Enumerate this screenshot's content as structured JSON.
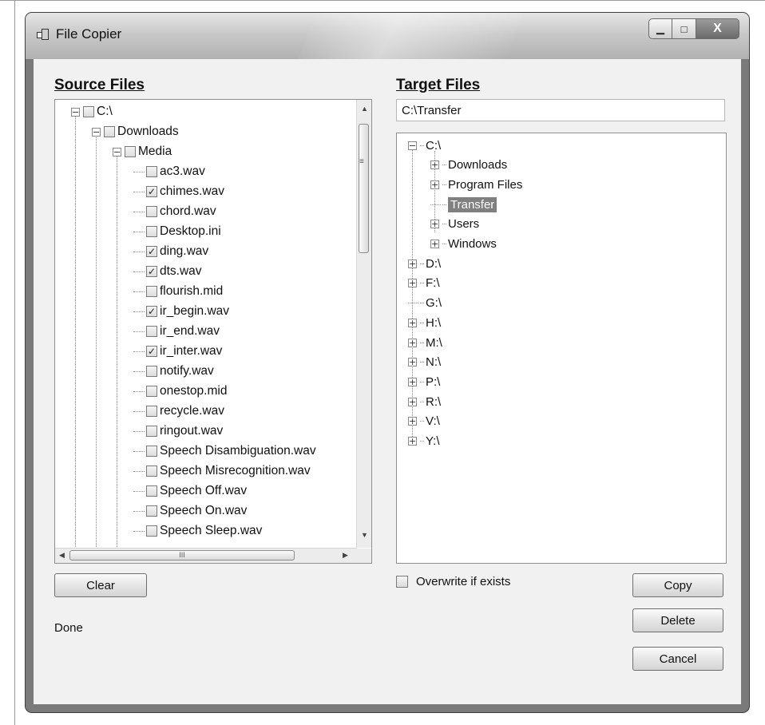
{
  "window": {
    "title": "File Copier",
    "minimize_icon": "minimize-icon",
    "maximize_icon": "maximize-icon",
    "close_icon": "close-icon"
  },
  "source": {
    "heading": "Source Files",
    "tree": [
      {
        "label": "C:\\",
        "level": 0,
        "expander": "minus",
        "checked": false
      },
      {
        "label": "Downloads",
        "level": 1,
        "expander": "minus",
        "checked": false
      },
      {
        "label": "Media",
        "level": 2,
        "expander": "minus",
        "checked": false
      },
      {
        "label": "ac3.wav",
        "level": 3,
        "checked": false
      },
      {
        "label": "chimes.wav",
        "level": 3,
        "checked": true
      },
      {
        "label": "chord.wav",
        "level": 3,
        "checked": false
      },
      {
        "label": "Desktop.ini",
        "level": 3,
        "checked": false
      },
      {
        "label": "ding.wav",
        "level": 3,
        "checked": true
      },
      {
        "label": "dts.wav",
        "level": 3,
        "checked": true
      },
      {
        "label": "flourish.mid",
        "level": 3,
        "checked": false
      },
      {
        "label": "ir_begin.wav",
        "level": 3,
        "checked": true
      },
      {
        "label": "ir_end.wav",
        "level": 3,
        "checked": false
      },
      {
        "label": "ir_inter.wav",
        "level": 3,
        "checked": true
      },
      {
        "label": "notify.wav",
        "level": 3,
        "checked": false
      },
      {
        "label": "onestop.mid",
        "level": 3,
        "checked": false
      },
      {
        "label": "recycle.wav",
        "level": 3,
        "checked": false
      },
      {
        "label": "ringout.wav",
        "level": 3,
        "checked": false
      },
      {
        "label": "Speech Disambiguation.wav",
        "level": 3,
        "checked": false
      },
      {
        "label": "Speech Misrecognition.wav",
        "level": 3,
        "checked": false
      },
      {
        "label": "Speech Off.wav",
        "level": 3,
        "checked": false
      },
      {
        "label": "Speech On.wav",
        "level": 3,
        "checked": false
      },
      {
        "label": "Speech Sleep.wav",
        "level": 3,
        "checked": false
      }
    ],
    "scroll_grip": "≡",
    "hscroll_grip": "III"
  },
  "target": {
    "heading": "Target Files",
    "path_value": "C:\\Transfer",
    "tree": [
      {
        "label": "C:\\",
        "level": 0,
        "expander": "minus"
      },
      {
        "label": "Downloads",
        "level": 1,
        "expander": "plus"
      },
      {
        "label": "Program Files",
        "level": 1,
        "expander": "plus"
      },
      {
        "label": "Transfer",
        "level": 1,
        "expander": "none",
        "selected": true
      },
      {
        "label": "Users",
        "level": 1,
        "expander": "plus"
      },
      {
        "label": "Windows",
        "level": 1,
        "expander": "plus"
      },
      {
        "label": "D:\\",
        "level": 0,
        "expander": "plus"
      },
      {
        "label": "F:\\",
        "level": 0,
        "expander": "plus"
      },
      {
        "label": "G:\\",
        "level": 0,
        "expander": "none"
      },
      {
        "label": "H:\\",
        "level": 0,
        "expander": "plus"
      },
      {
        "label": "M:\\",
        "level": 0,
        "expander": "plus"
      },
      {
        "label": "N:\\",
        "level": 0,
        "expander": "plus"
      },
      {
        "label": "P:\\",
        "level": 0,
        "expander": "plus"
      },
      {
        "label": "R:\\",
        "level": 0,
        "expander": "plus"
      },
      {
        "label": "V:\\",
        "level": 0,
        "expander": "plus"
      },
      {
        "label": "Y:\\",
        "level": 0,
        "expander": "plus"
      }
    ]
  },
  "buttons": {
    "clear": "Clear",
    "copy": "Copy",
    "delete": "Delete",
    "cancel": "Cancel"
  },
  "overwrite": {
    "label": "Overwrite if exists",
    "checked": false
  },
  "status": "Done",
  "colors": {
    "selection": "#808080",
    "window_frame": "#7a7a7a",
    "client_bg": "#f1f1f1"
  }
}
